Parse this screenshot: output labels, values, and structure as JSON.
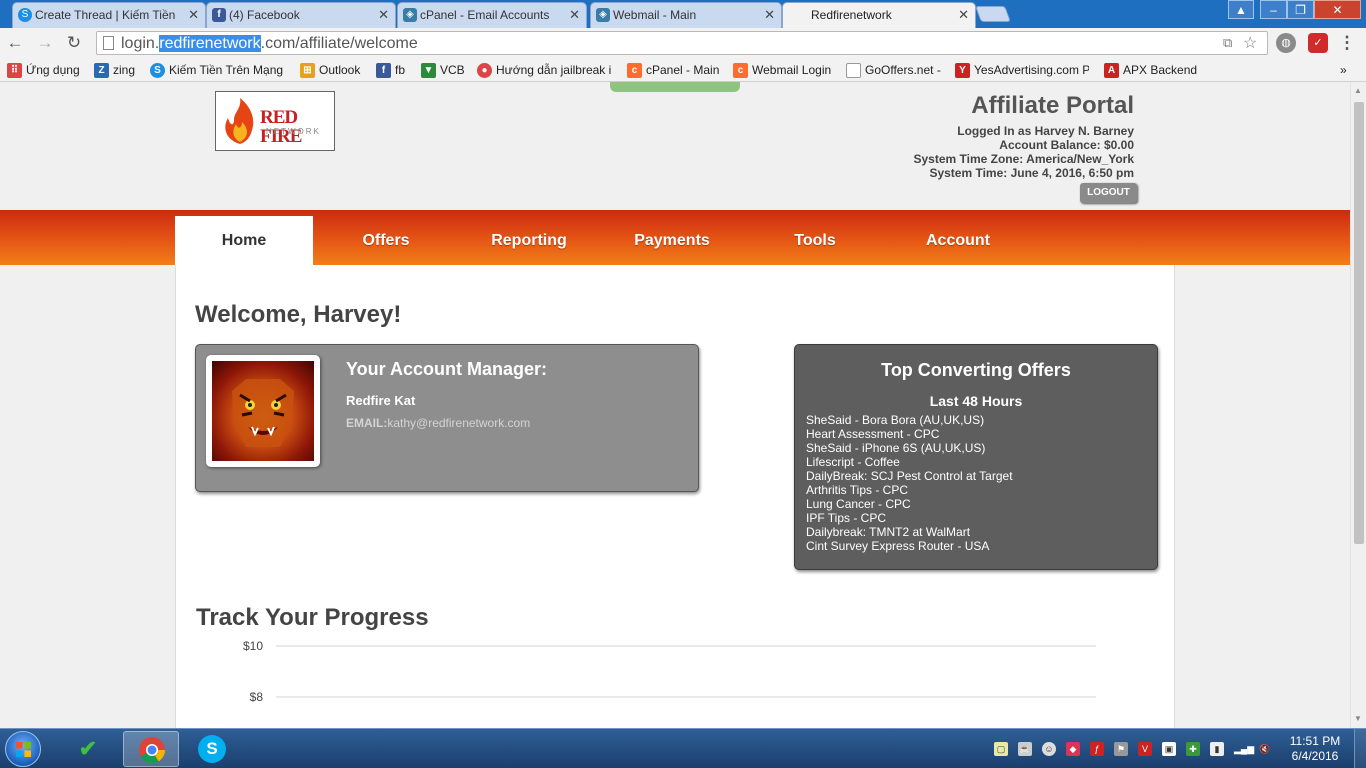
{
  "browser": {
    "tabs": [
      {
        "title": "Create Thread | Kiếm Tiền",
        "icon": "skype-s-icon",
        "color": "#1b8fe0"
      },
      {
        "title": "(4) Facebook",
        "icon": "facebook-icon",
        "color": "#3b5998"
      },
      {
        "title": "cPanel - Email Accounts",
        "icon": "cpanel-icon",
        "color": "#3a7ca8"
      },
      {
        "title": "Webmail - Main",
        "icon": "cpanel-icon",
        "color": "#3a7ca8"
      },
      {
        "title": "Redfirenetwork",
        "icon": "none",
        "color": "#ffffff"
      }
    ],
    "url": {
      "prefix": "login.",
      "highlight": "redfirenetwork",
      "suffix": ".com/affiliate/welcome"
    },
    "bookmarks": [
      {
        "label": "Ứng dụng",
        "icon": "apps-grid-icon",
        "color": "#d44"
      },
      {
        "label": "zing",
        "icon": "zing-icon",
        "color": "#2a6ab5"
      },
      {
        "label": "Kiếm Tiền Trên Mạng",
        "icon": "skype-s-icon",
        "color": "#1b8fe0"
      },
      {
        "label": "Outlook",
        "icon": "windows-icon",
        "color": "#e8a21a"
      },
      {
        "label": "fb",
        "icon": "facebook-icon",
        "color": "#3b5998"
      },
      {
        "label": "VCB",
        "icon": "shield-icon",
        "color": "#2d8a3a"
      },
      {
        "label": "Hướng dẫn jailbreak i",
        "icon": "apple-icon",
        "color": "#d44"
      },
      {
        "label": "cPanel - Main",
        "icon": "cpanel-icon",
        "color": "#ff6c2c"
      },
      {
        "label": "Webmail Login",
        "icon": "cpanel-icon",
        "color": "#ff6c2c"
      },
      {
        "label": "GoOffers.net -",
        "icon": "page-icon",
        "color": "#999"
      },
      {
        "label": "YesAdvertising.com P",
        "icon": "yes-icon",
        "color": "#c22"
      },
      {
        "label": "APX Backend",
        "icon": "apx-icon",
        "color": "#c22"
      }
    ]
  },
  "header": {
    "logo_text": "RED FIRE",
    "logo_sub": "NETWORK",
    "portal_title": "Affiliate Portal",
    "info_lines": [
      "Logged In as Harvey N. Barney",
      "Account Balance: $0.00",
      "System Time Zone: America/New_York",
      "System Time: June 4, 2016, 6:50 pm"
    ],
    "logout_label": "LOGOUT"
  },
  "nav": {
    "items": [
      "Home",
      "Offers",
      "Reporting",
      "Payments",
      "Tools",
      "Account"
    ],
    "active": "Home"
  },
  "main": {
    "welcome": "Welcome, Harvey!",
    "manager": {
      "title": "Your Account Manager:",
      "name": "Redfire Kat",
      "email_label": "EMAIL:",
      "email": "kathy@redfirenetwork.com"
    },
    "top_offers": {
      "title": "Top Converting Offers",
      "subtitle": "Last 48 Hours",
      "items": [
        "SheSaid - Bora Bora (AU,UK,US)",
        "Heart Assessment - CPC",
        "SheSaid - iPhone 6S (AU,UK,US)",
        "Lifescript - Coffee",
        "DailyBreak: SCJ Pest Control at Target",
        "Arthritis Tips - CPC",
        "Lung Cancer - CPC",
        "IPF Tips - CPC",
        "Dailybreak: TMNT2 at WalMart",
        "Cint Survey Express Router - USA"
      ]
    },
    "progress_title": "Track Your Progress"
  },
  "chart_data": {
    "type": "line",
    "title": "",
    "y_ticks": [
      "$10",
      "$8"
    ],
    "ylim": [
      8,
      10
    ],
    "series": [],
    "grid": true
  },
  "taskbar": {
    "clock_time": "11:51 PM",
    "clock_date": "6/4/2016"
  }
}
